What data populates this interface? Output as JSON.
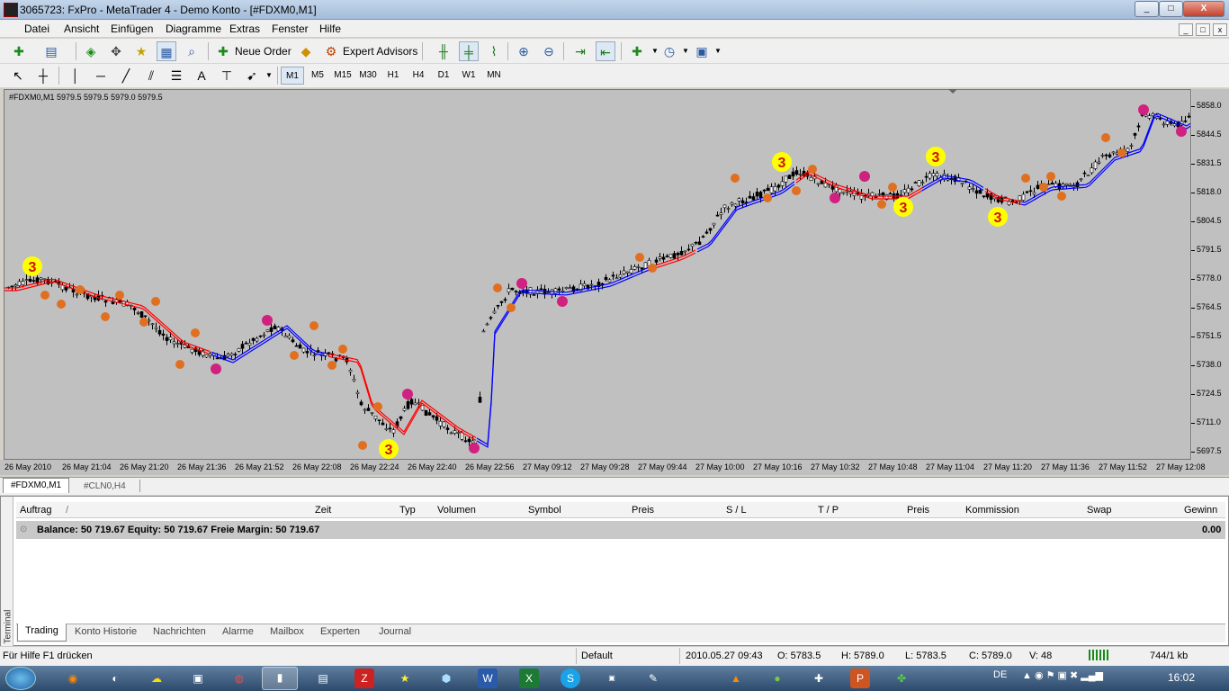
{
  "window": {
    "title": "3065723: FxPro - MetaTrader 4 - Demo Konto - [#FDXM0,M1]",
    "min": "_",
    "max": "□",
    "close": "X"
  },
  "menu": [
    "Datei",
    "Ansicht",
    "Einfügen",
    "Diagramme",
    "Extras",
    "Fenster",
    "Hilfe"
  ],
  "mdi_buttons": [
    "_",
    "□",
    "x"
  ],
  "toolbar1": {
    "new_order": "Neue Order",
    "expert_advisors": "Expert Advisors"
  },
  "toolbar2": {
    "text_tool": "A",
    "timeframes": [
      "M1",
      "M5",
      "M15",
      "M30",
      "H1",
      "H4",
      "D1",
      "W1",
      "MN"
    ]
  },
  "chart": {
    "info": "#FDXM0,M1  5979.5 5979.5 5979.0 5979.5",
    "price_labels": [
      "5858.0",
      "5844.5",
      "5831.5",
      "5818.0",
      "5804.5",
      "5791.5",
      "5778.0",
      "5764.5",
      "5751.5",
      "5738.0",
      "5724.5",
      "5711.0",
      "5697.5"
    ],
    "time_labels": [
      "26 May 2010",
      "26 May 21:04",
      "26 May 21:20",
      "26 May 21:36",
      "26 May 21:52",
      "26 May 22:08",
      "26 May 22:24",
      "26 May 22:40",
      "26 May 22:56",
      "27 May 09:12",
      "27 May 09:28",
      "27 May 09:44",
      "27 May 10:00",
      "27 May 10:16",
      "27 May 10:32",
      "27 May 10:48",
      "27 May 11:04",
      "27 May 11:20",
      "27 May 11:36",
      "27 May 11:52",
      "27 May 12:08"
    ],
    "colors": {
      "bg": "#c0c0c0",
      "ma_down": "#ff0000",
      "ma_up": "#0000ff",
      "marker1": "#e07020",
      "marker2": "#d02080",
      "marker3": "#ffff00"
    },
    "big_marker_label": "3"
  },
  "chart_tabs": [
    "#FDXM0,M1",
    "#CLN0,H4"
  ],
  "terminal": {
    "side_label": "Terminal",
    "columns": [
      "Auftrag",
      "/",
      "Zeit",
      "Typ",
      "Volumen",
      "Symbol",
      "Preis",
      "S / L",
      "T / P",
      "Preis",
      "Kommission",
      "Swap",
      "Gewinn"
    ],
    "balance": "Balance: 50 719.67  Equity: 50 719.67  Freie Margin: 50 719.67",
    "profit": "0.00",
    "tabs": [
      "Trading",
      "Konto Historie",
      "Nachrichten",
      "Alarme",
      "Mailbox",
      "Experten",
      "Journal"
    ]
  },
  "status": {
    "help": "Für Hilfe F1 drücken",
    "profile": "Default",
    "datetime": "2010.05.27 09:43",
    "open": "O: 5783.5",
    "high": "H: 5789.0",
    "low": "L: 5783.5",
    "close": "C: 5789.0",
    "volume": "V: 48",
    "traffic": "744/1 kb"
  },
  "taskbar": {
    "lang": "DE",
    "clock": "16:02"
  }
}
